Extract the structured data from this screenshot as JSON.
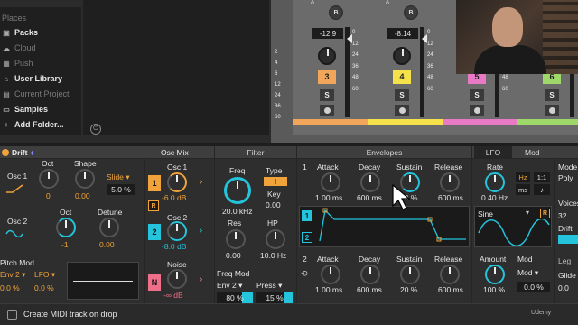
{
  "browser": {
    "places_header": "Places",
    "items": [
      {
        "label": "Packs",
        "icon": "packs-icon",
        "dim": false
      },
      {
        "label": "Cloud",
        "icon": "cloud-icon",
        "dim": true
      },
      {
        "label": "Push",
        "icon": "push-icon",
        "dim": true
      },
      {
        "label": "User Library",
        "icon": "user-library-icon",
        "dim": false
      },
      {
        "label": "Current Project",
        "icon": "project-icon",
        "dim": true
      },
      {
        "label": "Samples",
        "icon": "folder-icon",
        "dim": false
      },
      {
        "label": "Add Folder...",
        "icon": "plus-icon",
        "dim": false
      }
    ]
  },
  "mixer": {
    "left_scale": [
      "2",
      "4",
      "6",
      "12",
      "24",
      "36",
      "60"
    ],
    "strips": [
      {
        "send_a": "A",
        "send_b": "B",
        "volume": "-12.9",
        "number": "3",
        "solo": "S",
        "color": "#f2a65a",
        "scale": [
          "0",
          "12",
          "24",
          "36",
          "48",
          "60"
        ]
      },
      {
        "send_a": "A",
        "send_b": "B",
        "volume": "-8.14",
        "number": "4",
        "solo": "S",
        "color": "#f5e14a",
        "scale": [
          "0",
          "12",
          "24",
          "36",
          "48",
          "60"
        ]
      },
      {
        "send_a": "A",
        "send_b": "B",
        "volume": "",
        "number": "5",
        "solo": "S",
        "color": "#e879c4",
        "scale": [
          "0",
          "12",
          "24",
          "36",
          "48",
          "60"
        ]
      },
      {
        "send_a": "A",
        "send_b": "",
        "volume": "",
        "number": "6",
        "solo": "S",
        "color": "#9fd86a",
        "scale": [
          "",
          "",
          "",
          "",
          "",
          ""
        ]
      }
    ]
  },
  "device": {
    "name": "Drift",
    "headers": {
      "osc_mix": "Osc Mix",
      "filter": "Filter",
      "envelopes": "Envelopes",
      "lfo_tab": "LFO",
      "mod_tab": "Mod"
    },
    "osc1": {
      "label": "Osc 1",
      "oct_label": "Oct",
      "oct_value": "0",
      "shape_label": "Shape",
      "shape_value": "0.00",
      "mode": "Slide",
      "mode_value": "5.0 %"
    },
    "osc2": {
      "label": "Osc 2",
      "oct_label": "Oct",
      "oct_value": "-1",
      "detune_label": "Detune",
      "detune_value": "0.00"
    },
    "pitch_mod": {
      "label": "Pitch Mod",
      "src1": "Env 2",
      "src2": "LFO",
      "amt1": "0.0 %",
      "amt2": "0.0 %"
    },
    "mix": {
      "osc1_label": "Osc 1",
      "osc1_value": "-6.0 dB",
      "osc2_label": "Osc 2",
      "osc2_value": "-8.0 dB",
      "noise_label": "Noise",
      "noise_value": "-∞ dB",
      "chip1": "1",
      "chip2": "2",
      "chip_r": "R",
      "chip_n": "N"
    },
    "filter": {
      "freq_label": "Freq",
      "freq_value": "20.0 kHz",
      "type_label": "Type",
      "type_value": "I",
      "key_label": "Key",
      "key_value": "0.00",
      "res_label": "Res",
      "res_value": "0.00",
      "hp_label": "HP",
      "hp_value": "10.0 Hz",
      "freq_mod_label": "Freq Mod",
      "mod_src1": "Env 2",
      "mod_src2": "Press",
      "mod_amt1": "80 %",
      "mod_amt2": "15 %"
    },
    "env1": {
      "num": "1",
      "attack_label": "Attack",
      "attack_value": "1.00 ms",
      "decay_label": "Decay",
      "decay_value": "600 ms",
      "sustain_label": "Sustain",
      "sustain_value": "70 %",
      "release_label": "Release",
      "release_value": "600 ms"
    },
    "env2": {
      "num": "2",
      "attack_label": "Attack",
      "attack_value": "1.00 ms",
      "decay_label": "Decay",
      "decay_value": "600 ms",
      "sustain_label": "Sustain",
      "sustain_value": "20 %",
      "release_label": "Release",
      "release_value": "600 ms"
    },
    "env_display": {
      "tab1": "1",
      "tab2": "2"
    },
    "lfo": {
      "rate_label": "Rate",
      "rate_value": "0.40 Hz",
      "hz_btn": "Hz",
      "ms_btn": "ms",
      "ratio_btn": "1:1",
      "wave": "Sine",
      "retrig": "R",
      "amount_label": "Amount",
      "amount_value": "100 %",
      "mod_label": "Mod",
      "mod_src": "Mod",
      "mod_value": "0.0 %"
    },
    "right": {
      "mode_label": "Mode",
      "mode_value": "Poly",
      "voices_label": "Voices",
      "voices_value": "32",
      "drift_label": "Drift",
      "drift_value": "",
      "legato": "Leg",
      "glide_label": "Glide",
      "glide_value": "0.0"
    }
  },
  "status": {
    "text": "Create MIDI track on drop"
  },
  "watermark": "Udemy",
  "colors": {
    "accent": "#23c4dc",
    "orange": "#f0a33a",
    "panel": "#2e2e2e"
  }
}
